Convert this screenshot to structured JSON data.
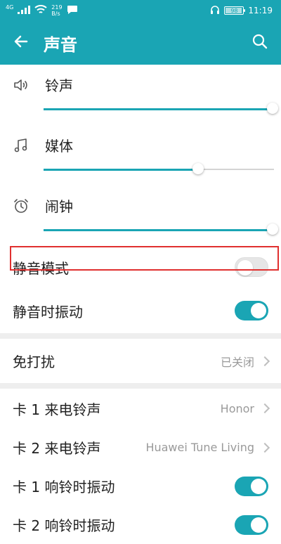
{
  "status_bar": {
    "signal_label": "4G",
    "net_speed_value": "219",
    "net_speed_unit": "B/s",
    "battery_level": "98",
    "time": "11:19"
  },
  "app_bar": {
    "title": "声音"
  },
  "volumes": [
    {
      "label": "铃声",
      "level": 1.0
    },
    {
      "label": "媒体",
      "level": 0.67
    },
    {
      "label": "闹钟",
      "level": 1.0
    }
  ],
  "settings": {
    "silent_mode": {
      "label": "静音模式",
      "on": false
    },
    "vibrate_on_silent": {
      "label": "静音时振动",
      "on": true
    },
    "dnd": {
      "label": "免打扰",
      "value": "已关闭"
    },
    "sim1_ringtone": {
      "label": "卡 1 来电铃声",
      "value": "Honor"
    },
    "sim2_ringtone": {
      "label": "卡 2 来电铃声",
      "value": "Huawei Tune Living"
    },
    "sim1_vibrate": {
      "label": "卡 1 响铃时振动",
      "on": true
    },
    "sim2_vibrate": {
      "label": "卡 2 响铃时振动",
      "on": true
    }
  },
  "colors": {
    "accent": "#1aa5b4",
    "highlight_border": "#e0302f"
  },
  "icons": {
    "back": "arrow-left-icon",
    "search": "search-icon",
    "ringtone": "speaker-icon",
    "media": "music-note-icon",
    "alarm": "alarm-clock-icon"
  }
}
